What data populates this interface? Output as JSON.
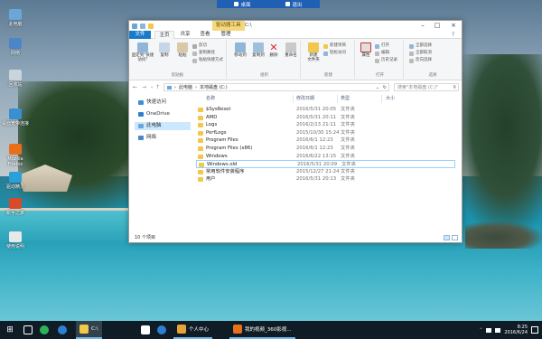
{
  "remote_bar": {
    "items": [
      {
        "label": "桌面",
        "icon": "desktop-icon"
      },
      {
        "label": "退出",
        "icon": "exit-icon"
      }
    ]
  },
  "desktop": {
    "icons": [
      {
        "label": "此电脑",
        "icon": "computer-icon",
        "color": "#6aa6d8"
      },
      {
        "label": "网络",
        "icon": "network-icon",
        "color": "#4d86c7"
      },
      {
        "label": "回收站",
        "icon": "recycle-bin-icon",
        "color": "#c9d4dc"
      },
      {
        "label": "桌面宽带连接",
        "icon": "broadband-icon",
        "color": "#3a8fd0"
      },
      {
        "label": "Mozilla Firefox",
        "icon": "firefox-icon",
        "color": "#e8701a"
      },
      {
        "label": "驱动精灵",
        "icon": "driver-icon",
        "color": "#2aa0d8"
      },
      {
        "label": "新手之家",
        "icon": "home-icon",
        "color": "#d84a2a"
      },
      {
        "label": "使用说明",
        "icon": "doc-icon",
        "color": "#e8e8e8"
      }
    ]
  },
  "window": {
    "context_tab": "驱动器工具",
    "title": "C:\\",
    "tabs": [
      "文件",
      "主页",
      "共享",
      "查看",
      "管理"
    ],
    "ribbon": {
      "clipboard": {
        "group_label": "剪贴板",
        "pin": "固定到\"快速访问\"",
        "copy": "复制",
        "paste": "粘贴",
        "cut": "剪切",
        "copy_path": "复制路径",
        "paste_shortcut": "粘贴快捷方式"
      },
      "organize": {
        "group_label": "组织",
        "move_to": "移动到",
        "copy_to": "复制到",
        "delete": "删除",
        "rename": "重命名"
      },
      "new": {
        "group_label": "新建",
        "new_folder": "新建\n文件夹",
        "new_item": "新建项目",
        "easy_access": "轻松访问"
      },
      "open": {
        "group_label": "打开",
        "properties": "属性",
        "open": "打开",
        "edit": "编辑",
        "history": "历史记录"
      },
      "select": {
        "group_label": "选择",
        "select_all": "全部选择",
        "select_none": "全部取消",
        "invert": "反向选择"
      }
    },
    "address": {
      "path": [
        "此电脑",
        "本地磁盘 (C:)"
      ],
      "search_placeholder": "搜索\"本地磁盘 (C:)\""
    },
    "nav_items": [
      {
        "label": "快速访问",
        "icon": "star-icon",
        "color": "#3f8fd8"
      },
      {
        "label": "OneDrive",
        "icon": "onedrive-icon",
        "color": "#2f7fd0"
      },
      {
        "label": "此电脑",
        "icon": "computer-icon",
        "color": "#6aa6d8",
        "selected": true
      },
      {
        "label": "网络",
        "icon": "network-icon",
        "color": "#4d86c7"
      }
    ],
    "columns": {
      "name": "名称",
      "date": "修改日期",
      "type": "类型",
      "size": "大小"
    },
    "files": [
      {
        "name": "$SysReset",
        "date": "2016/5/31 20:05",
        "type": "文件夹"
      },
      {
        "name": "AMD",
        "date": "2016/5/31 20:11",
        "type": "文件夹"
      },
      {
        "name": "Logs",
        "date": "2016/2/13 21:11",
        "type": "文件夹"
      },
      {
        "name": "PerfLogs",
        "date": "2015/10/30 15:24",
        "type": "文件夹"
      },
      {
        "name": "Program Files",
        "date": "2016/6/1 12:23",
        "type": "文件夹"
      },
      {
        "name": "Program Files (x86)",
        "date": "2016/6/1 12:23",
        "type": "文件夹"
      },
      {
        "name": "Windows",
        "date": "2016/6/22 13:15",
        "type": "文件夹"
      },
      {
        "name": "Windows.old",
        "date": "2016/5/31 20:09",
        "type": "文件夹",
        "selected": true
      },
      {
        "name": "常用软件安装程序",
        "date": "2015/12/27 21:24",
        "type": "文件夹"
      },
      {
        "name": "用户",
        "date": "2016/5/31 20:13",
        "type": "文件夹"
      }
    ],
    "status": "10 个项目"
  },
  "taskbar": {
    "apps": [
      {
        "label": "C:\\",
        "icon": "explorer-icon",
        "color": "#f1c84b",
        "active": true
      },
      {
        "label": "个人中心",
        "icon": "user-center-icon",
        "color": "#e8a23a"
      },
      {
        "label": "我的视频_360影视...",
        "icon": "browser-360-icon",
        "color": "#e8701a"
      }
    ],
    "clock": {
      "time": "8:25",
      "date": "2016/6/24"
    }
  }
}
